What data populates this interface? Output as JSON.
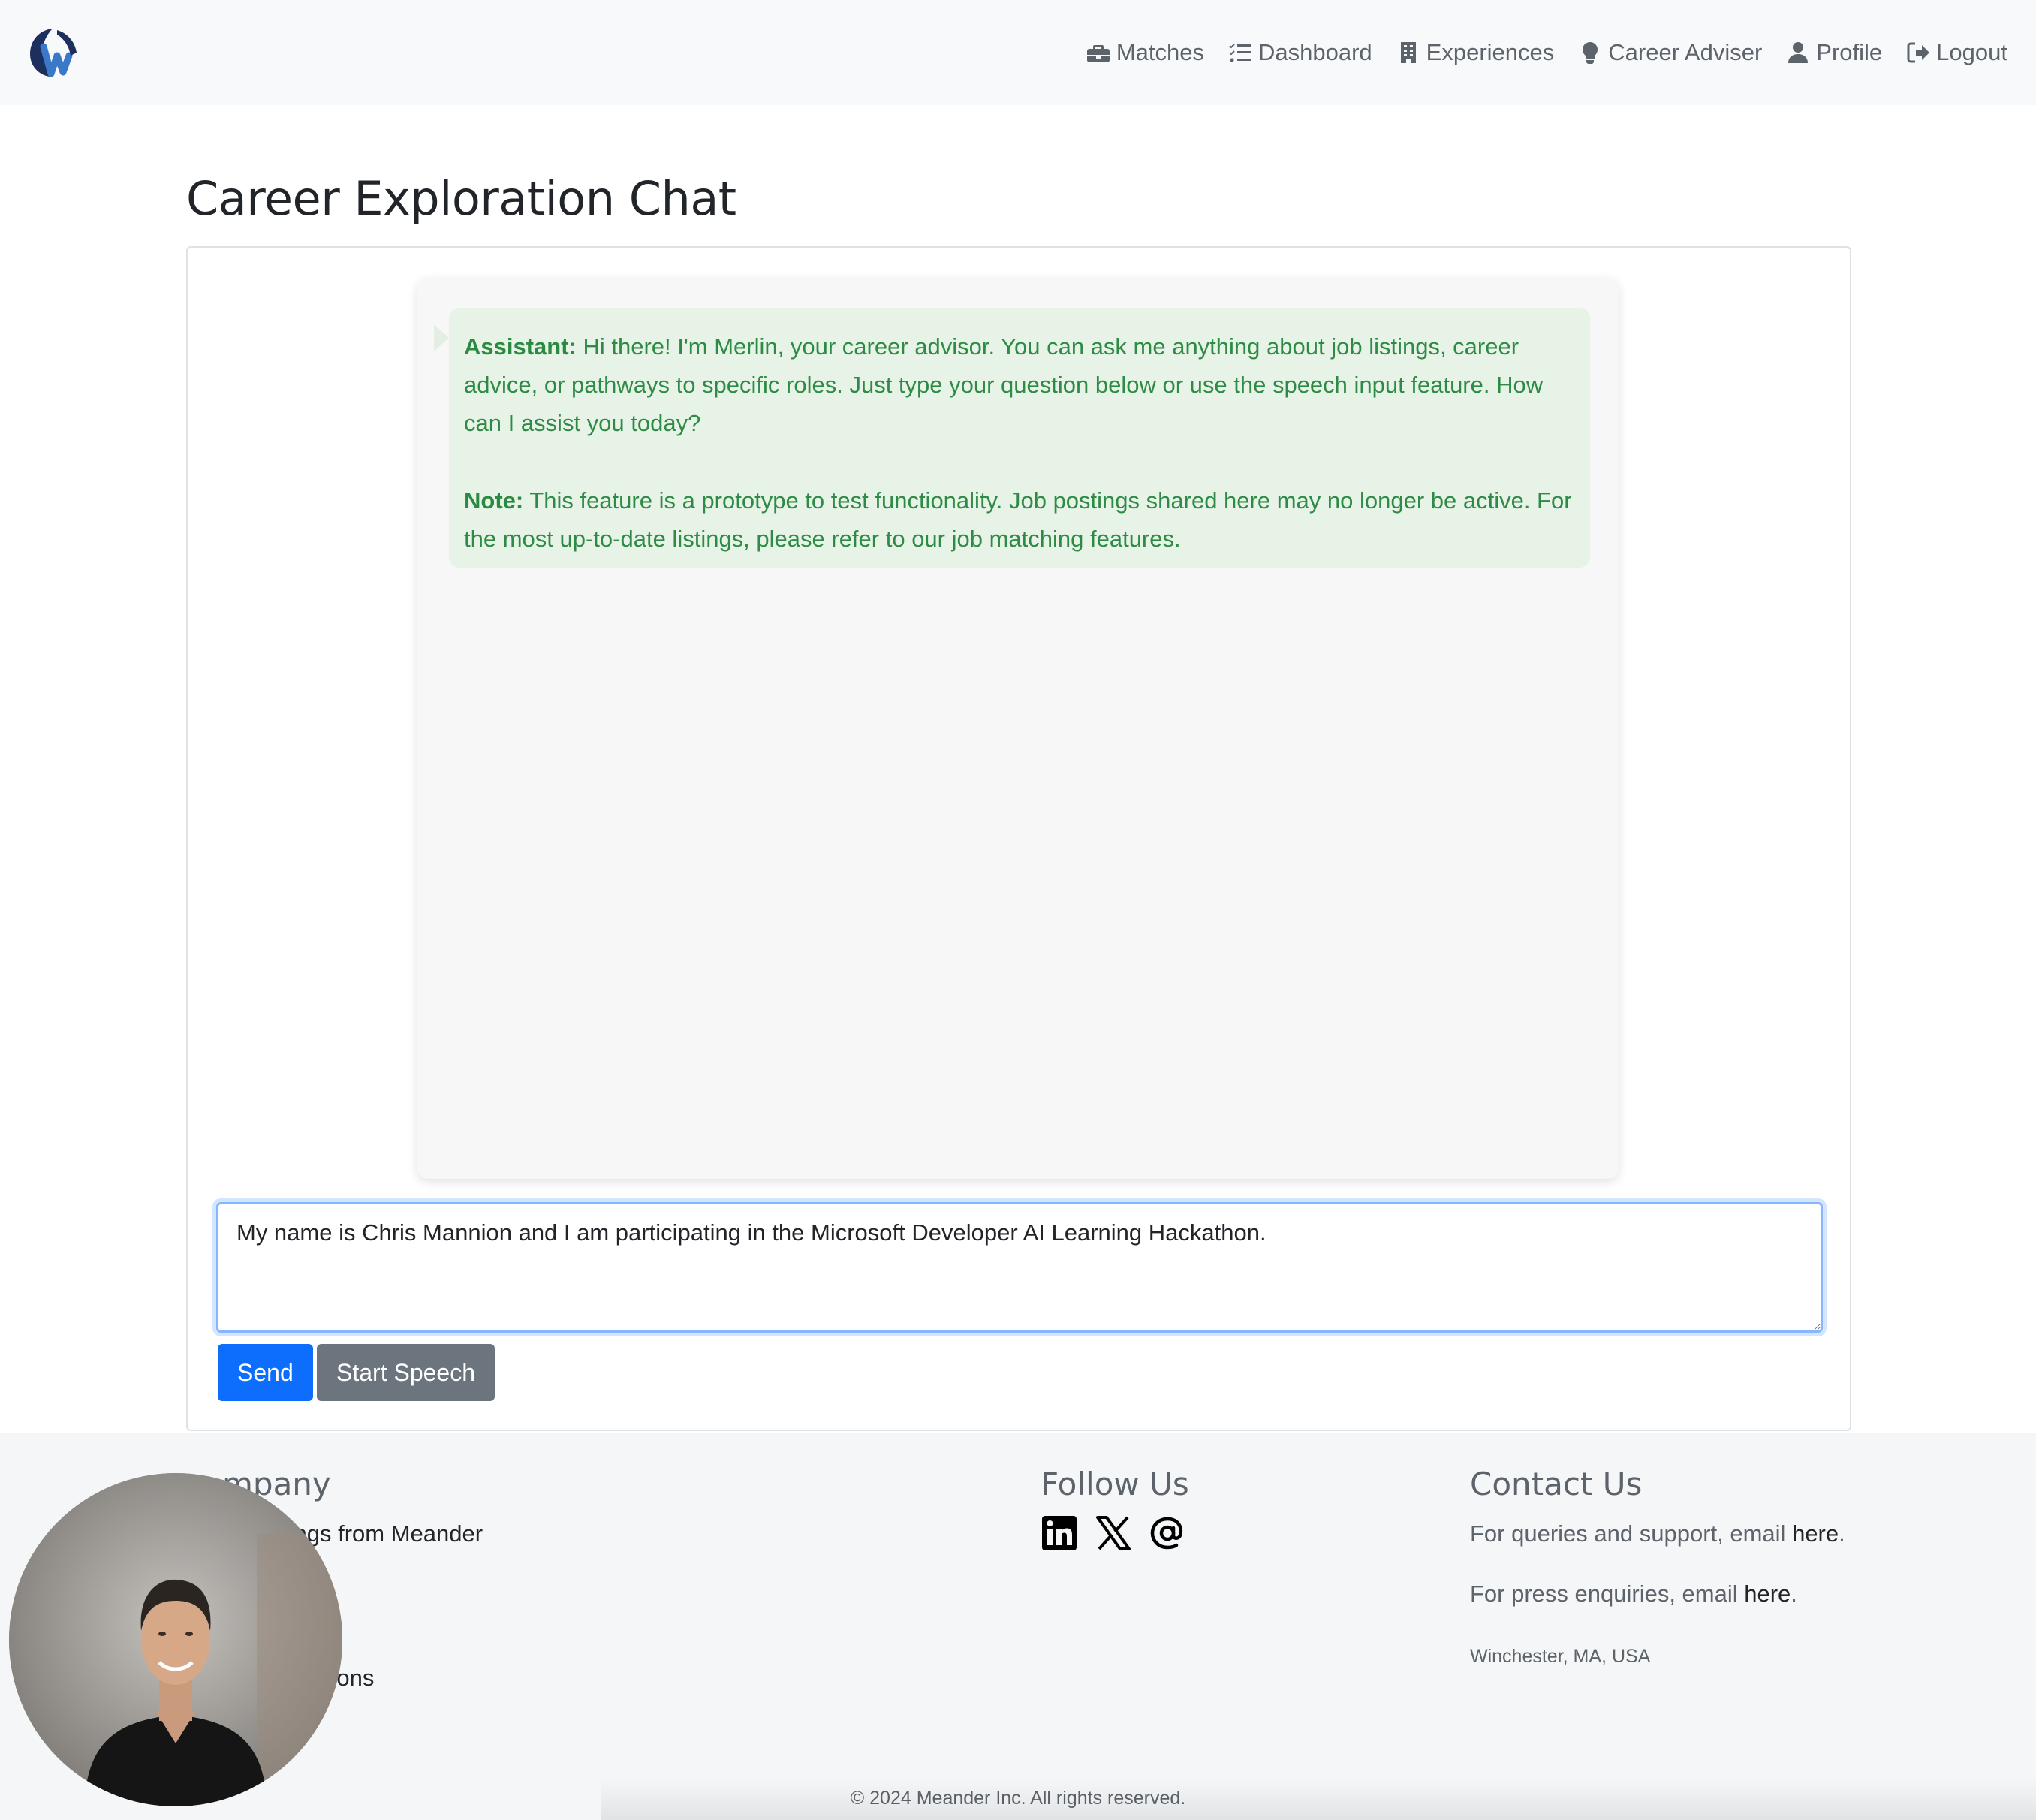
{
  "nav": {
    "items": [
      {
        "label": "Matches",
        "icon": "briefcase-icon"
      },
      {
        "label": "Dashboard",
        "icon": "list-check-icon"
      },
      {
        "label": "Experiences",
        "icon": "building-icon"
      },
      {
        "label": "Career Adviser",
        "icon": "lightbulb-icon"
      },
      {
        "label": "Profile",
        "icon": "user-icon"
      },
      {
        "label": "Logout",
        "icon": "logout-icon"
      }
    ]
  },
  "page": {
    "title": "Career Exploration Chat"
  },
  "chat": {
    "messages": [
      {
        "role_label": "Assistant:",
        "text": "Hi there! I'm Merlin, your career advisor. You can ask me anything about job listings, career advice, or pathways to specific roles. Just type your question below or use the speech input feature. How can I assist you today?",
        "note_label": "Note:",
        "note_text": "This feature is a prototype to test functionality. Job postings shared here may no longer be active. For the most up-to-date listings, please refer to our job matching features."
      }
    ],
    "input_value": "My name is Chris Mannion and I am participating in the Microsoft Developer AI Learning Hackathon.",
    "send_label": "Send",
    "speech_label": "Start Speech"
  },
  "footer": {
    "company_heading": "mpany",
    "company_links": [
      "tings from Meander",
      "itions"
    ],
    "follow_heading": "Follow Us",
    "social": [
      "linkedin-icon",
      "x-icon",
      "email-at-icon"
    ],
    "contact_heading": "Contact Us",
    "contact_support_prefix": "For queries and support, email ",
    "contact_press_prefix": "For press enquiries, email ",
    "contact_link": "here",
    "contact_suffix": ".",
    "address": "Winchester, MA, USA",
    "copyright": "© 2024 Meander Inc. All rights reserved."
  },
  "colors": {
    "primary": "#0d6efd",
    "secondary": "#6c757d",
    "assistant_text": "#2e8b45",
    "assistant_bg": "#e7f3e7",
    "logo_navy": "#1d2f5c",
    "logo_blue": "#3a78c9"
  }
}
